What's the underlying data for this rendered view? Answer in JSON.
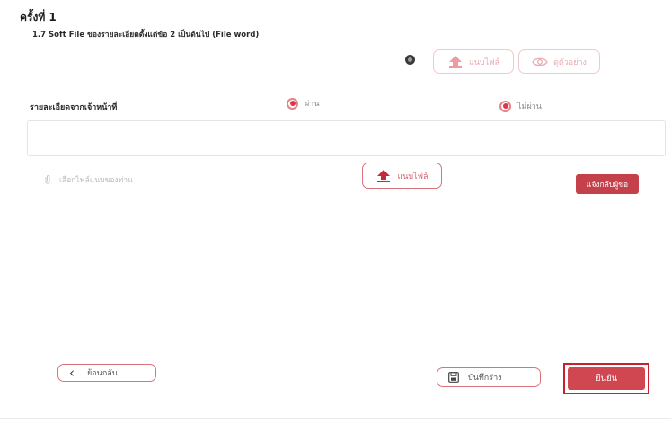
{
  "header": {
    "title": "ครั้งที่ 1",
    "subtitle": "1.7 Soft File ของรายละเอียดตั้งแต่ข้อ 2 เป็นต้นไป (File word)"
  },
  "top_actions": {
    "attach_label": "แนบไฟล์",
    "preview_label": "ดูตัวอย่าง"
  },
  "review": {
    "label": "รายละเอียดจากเจ้าหน้าที่",
    "options": [
      {
        "label": "ผ่าน",
        "selected": true
      },
      {
        "label": "ไม่ผ่าน",
        "selected": true
      }
    ],
    "comment_value": ""
  },
  "attachment": {
    "placeholder": "เลือกไฟล์แนบของท่าน",
    "upload_label": "แนบไฟล์",
    "notify_label": "แจ้งกลับผู้ขอ"
  },
  "footer": {
    "back_label": "ย้อนกลับ",
    "save_draft_label": "บันทึกร่าง",
    "confirm_label": "ยืนยัน"
  },
  "colors": {
    "accent": "#c4414c",
    "radio": "#d8384a",
    "highlight_frame": "#c9202d"
  }
}
